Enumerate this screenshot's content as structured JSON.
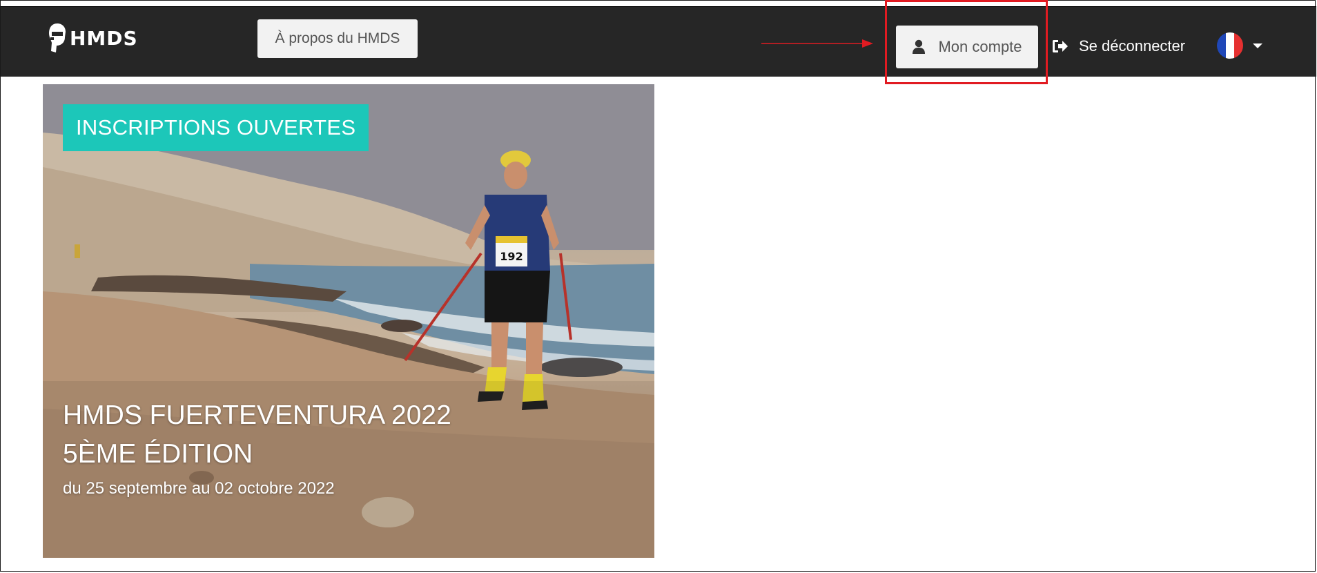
{
  "navbar": {
    "logo_text": "HMDS",
    "about_label": "À propos du HMDS",
    "account_label": "Mon compte",
    "logout_label": "Se déconnecter",
    "language_icon": "france-flag-icon"
  },
  "annotation": {
    "color": "#e11b22",
    "target": "account-button"
  },
  "event": {
    "badge": "INSCRIPTIONS OUVERTES",
    "title_line1": "HMDS FUERTEVENTURA 2022",
    "title_line2": "5ÈME ÉDITION",
    "dates": "du 25 septembre au 02 octobre 2022",
    "bib_number": "192"
  },
  "colors": {
    "navbar_bg": "#262626",
    "badge_bg": "#1cc7b9",
    "button_bg": "#f2f2f2"
  }
}
